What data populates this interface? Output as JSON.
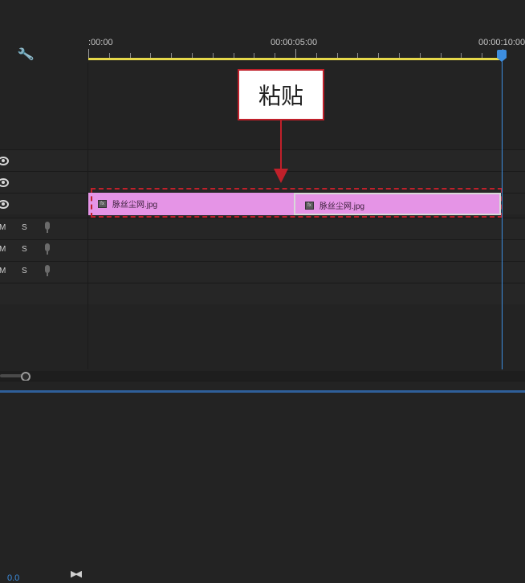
{
  "ruler": {
    "timecodes": [
      ":00:00",
      "00:00:05:00",
      "00:00:10:00"
    ]
  },
  "tracks": {
    "audio": [
      {
        "mute_label": "M",
        "solo_label": "S"
      },
      {
        "mute_label": "M",
        "solo_label": "S"
      },
      {
        "mute_label": "M",
        "solo_label": "S"
      }
    ],
    "master_volume": "0.0"
  },
  "clips": [
    {
      "name": "脉丝尘网.jpg",
      "fx_label": "fx"
    },
    {
      "name": "脉丝尘网.jpg",
      "fx_label": "fx"
    }
  ],
  "annotation": {
    "label": "粘贴",
    "color": "#c0202a"
  },
  "colors": {
    "clip": "#e594e6",
    "playhead": "#3d8ee0",
    "work_area": "#e6d84a"
  },
  "icons": [
    "wrench-icon",
    "eye-icon",
    "microphone-icon",
    "bow-tie-icon",
    "playhead-icon"
  ]
}
